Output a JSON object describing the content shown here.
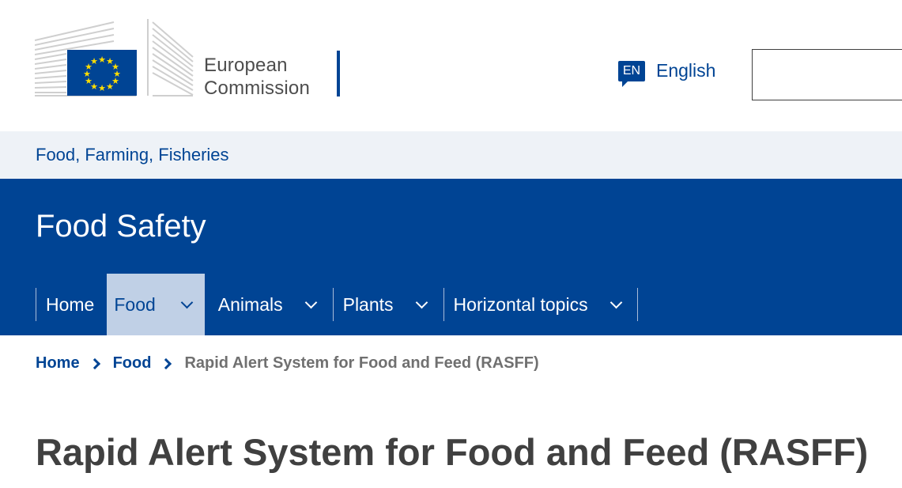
{
  "header": {
    "logo_line1": "European",
    "logo_line2": "Commission",
    "language_code": "EN",
    "language_label": "English",
    "search_placeholder": ""
  },
  "site": {
    "name": "Food, Farming, Fisheries"
  },
  "banner": {
    "title": "Food Safety",
    "menu": [
      {
        "label": "Home",
        "has_dropdown": false,
        "active": false
      },
      {
        "label": "Food",
        "has_dropdown": true,
        "active": true
      },
      {
        "label": "Animals",
        "has_dropdown": true,
        "active": false
      },
      {
        "label": "Plants",
        "has_dropdown": true,
        "active": false
      },
      {
        "label": "Horizontal topics",
        "has_dropdown": true,
        "active": false
      }
    ]
  },
  "breadcrumb": {
    "items": [
      "Home",
      "Food"
    ],
    "current": "Rapid Alert System for Food and Feed (RASFF)"
  },
  "page": {
    "title": "Rapid Alert System for Food and Feed (RASFF)"
  },
  "colors": {
    "brand_blue": "#004494",
    "flag_star": "#ffde00",
    "active_menu_bg": "#c0d0e6",
    "site_bar_bg": "#eef2f7",
    "title_text": "#404040"
  },
  "icons": {
    "logo": "european-commission-logo",
    "language": "speech-bubble-icon",
    "dropdown": "chevron-down-icon",
    "breadcrumb_separator": "chevron-right-icon"
  }
}
